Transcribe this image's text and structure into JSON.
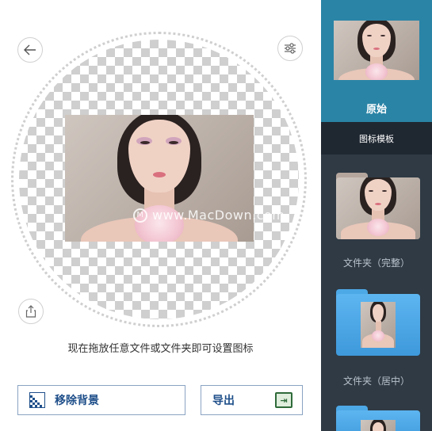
{
  "window": {
    "traffic_lights": [
      "close",
      "minimize",
      "zoom"
    ]
  },
  "toolbar": {
    "back_icon": "arrow-left-icon",
    "settings_icon": "sliders-icon",
    "share_icon": "share-icon"
  },
  "canvas": {
    "watermark": "www.MacDown.com",
    "watermark_logo": "M",
    "hint": "现在拖放任意文件或文件夹即可设置图标"
  },
  "actions": {
    "remove_bg_label": "移除背景",
    "export_label": "导出"
  },
  "sidebar": {
    "original_label": "原始",
    "templates_header": "图标模板",
    "folder_full_label": "文件夹（完整）",
    "folder_center_label": "文件夹（居中）"
  },
  "colors": {
    "accent": "#2a84a6",
    "sidebar": "#2f3a44",
    "sidebar_header": "#1f2731",
    "button_text": "#1f4f8a",
    "folder_blue": "#4da8e6"
  }
}
